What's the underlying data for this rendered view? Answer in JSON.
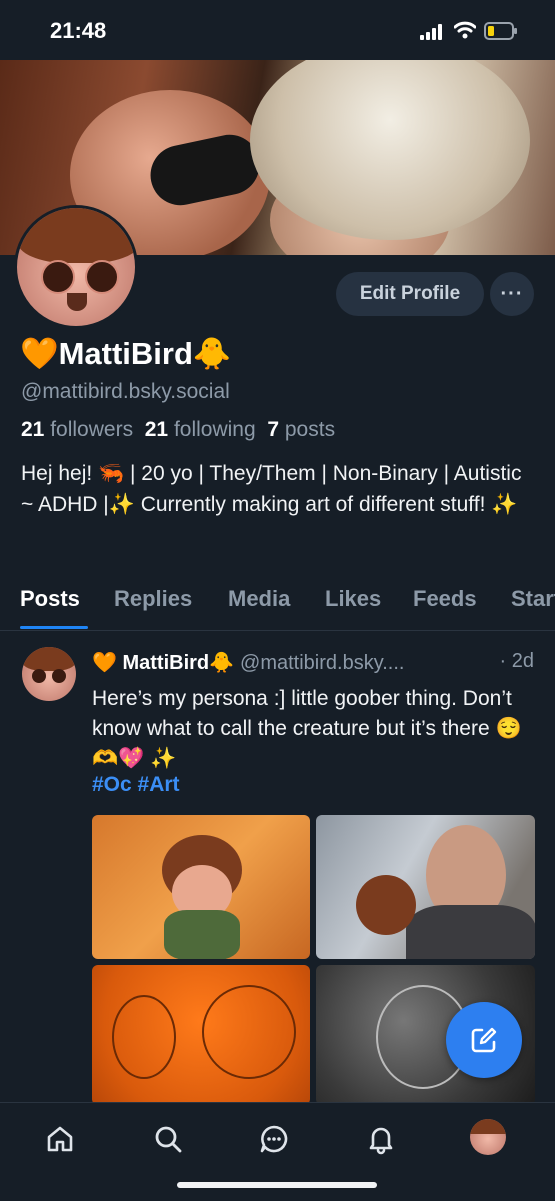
{
  "status_bar": {
    "time": "21:48"
  },
  "profile": {
    "display_name": "🧡MattiBird🐥",
    "handle": "@mattibird.bsky.social",
    "followers_count": "21",
    "followers_label": "followers",
    "following_count": "21",
    "following_label": "following",
    "posts_count": "7",
    "posts_label": "posts",
    "bio": "Hej hej! 🦐 | 20 yo | They/Them | Non-Binary | Autistic ~ ADHD |✨ Currently making art of different stuff! ✨",
    "edit_label": "Edit Profile",
    "more_label": "···"
  },
  "tabs": [
    {
      "label": "Posts",
      "active": true
    },
    {
      "label": "Replies"
    },
    {
      "label": "Media"
    },
    {
      "label": "Likes"
    },
    {
      "label": "Feeds"
    },
    {
      "label": "Starter Packs"
    }
  ],
  "post": {
    "author_name": "🧡 MattiBird🐥",
    "author_handle": "@mattibird.bsky....",
    "time": "· 2d",
    "text": "Here’s my persona :] little goober thing. Don’t know what to call the creature but it’s there 😌🫶💖 ✨",
    "tags": "#Oc #Art",
    "images": [
      {
        "icon": "artwork-persona-orange"
      },
      {
        "icon": "artwork-persona-with-person"
      },
      {
        "icon": "artwork-sketch-orange"
      },
      {
        "icon": "artwork-sketch-grey"
      }
    ]
  },
  "bottom_nav": [
    {
      "icon": "home-icon"
    },
    {
      "icon": "search-icon"
    },
    {
      "icon": "chat-icon"
    },
    {
      "icon": "bell-icon"
    },
    {
      "icon": "profile-avatar"
    }
  ],
  "colors": {
    "background": "#161e27",
    "accent": "#1f85f5",
    "link": "#3b8ef5",
    "muted": "#8d9aa8"
  }
}
